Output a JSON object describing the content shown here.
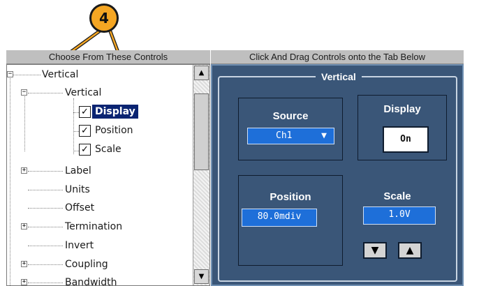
{
  "callout": {
    "number": "4",
    "color": "#f5a623"
  },
  "left_panel": {
    "header": "Choose From These Controls",
    "tree": [
      {
        "label": "Vertical",
        "expander": "−"
      },
      {
        "label": "Vertical",
        "expander": "−"
      },
      {
        "label": "Display",
        "checked": true,
        "selected": true
      },
      {
        "label": "Position",
        "checked": true
      },
      {
        "label": "Scale",
        "checked": true
      },
      {
        "label": "Label",
        "expander": "+"
      },
      {
        "label": "Units"
      },
      {
        "label": "Offset"
      },
      {
        "label": "Termination",
        "expander": "+"
      },
      {
        "label": "Invert"
      },
      {
        "label": "Coupling",
        "expander": "+"
      },
      {
        "label": "Bandwidth",
        "expander": "+"
      }
    ],
    "scroll_up_icon": "triangle-up",
    "scroll_down_icon": "triangle-down"
  },
  "right_panel": {
    "header": "Click And Drag Controls onto the Tab Below",
    "group_title": "Vertical",
    "source": {
      "label": "Source",
      "value": "Ch1",
      "arrow": "▼"
    },
    "display": {
      "label": "Display",
      "value": "On"
    },
    "position": {
      "label": "Position",
      "value": "80.0mdiv"
    },
    "scale": {
      "label": "Scale",
      "value": "1.0V",
      "down": "▼",
      "up": "▲"
    }
  },
  "colors": {
    "tab_background": "#3a5678",
    "selection": "#0a2472",
    "value_field": "#1e6fd9",
    "callout": "#f5a623"
  }
}
